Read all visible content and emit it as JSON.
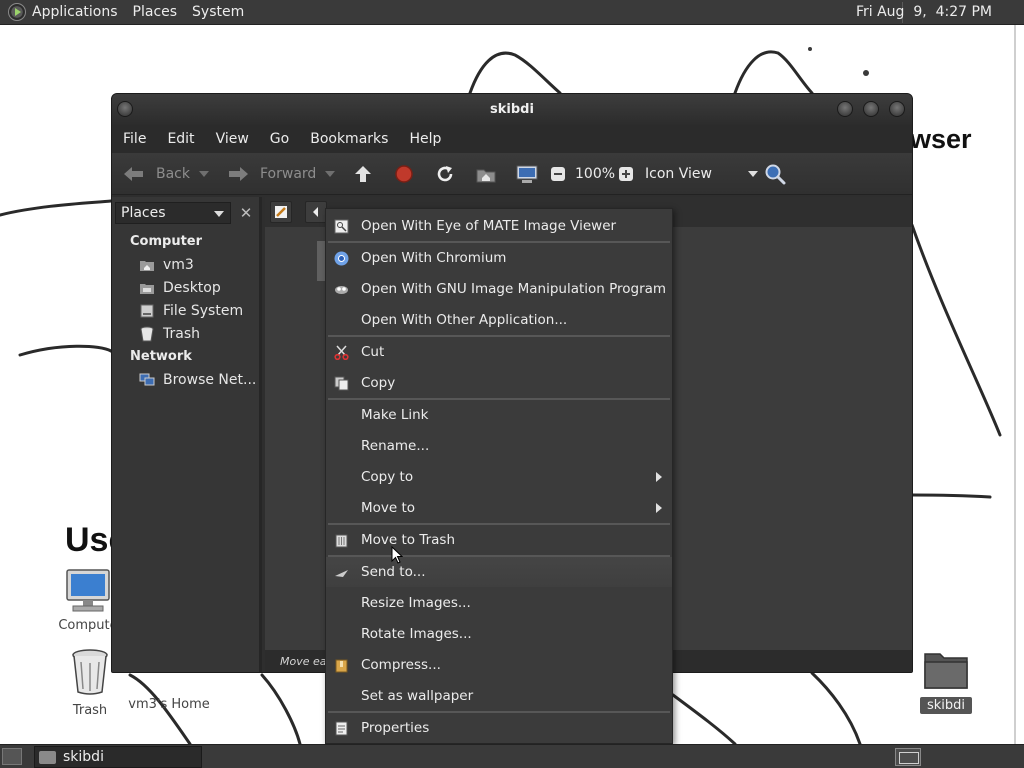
{
  "top_panel": {
    "menus": [
      "Applications",
      "Places",
      "System"
    ],
    "clock": "Fri Aug  9,  4:27 PM"
  },
  "desktop": {
    "bg_text_left": "Use",
    "bg_text_right": "wser",
    "icons": [
      {
        "label": "Compute",
        "icon": "computer-icon"
      },
      {
        "label": "Trash",
        "icon": "trash-icon"
      },
      {
        "label": "vm3's Home",
        "icon": "home-folder-icon"
      },
      {
        "label": "skibdi",
        "icon": "folder-icon"
      }
    ]
  },
  "window": {
    "title": "skibdi",
    "menu": [
      "File",
      "Edit",
      "View",
      "Go",
      "Bookmarks",
      "Help"
    ],
    "toolbar": {
      "back": "Back",
      "forward": "Forward",
      "zoom": "100%",
      "view_mode": "Icon View"
    },
    "sidebar": {
      "selector": "Places",
      "sections": [
        {
          "title": "Computer",
          "items": [
            {
              "label": "vm3",
              "icon": "home-icon"
            },
            {
              "label": "Desktop",
              "icon": "desktop-icon"
            },
            {
              "label": "File System",
              "icon": "drive-icon"
            },
            {
              "label": "Trash",
              "icon": "trash-icon"
            }
          ]
        },
        {
          "title": "Network",
          "items": [
            {
              "label": "Browse Net...",
              "icon": "network-icon"
            }
          ]
        }
      ]
    },
    "status": "Move eac"
  },
  "context_menu": {
    "items": [
      {
        "label": "Open With Eye of MATE Image Viewer",
        "icon": "image-viewer-icon"
      },
      {
        "label": "Open With Chromium",
        "icon": "chromium-icon"
      },
      {
        "label": "Open With GNU Image Manipulation Program",
        "icon": "gimp-icon"
      },
      {
        "label": "Open With Other Application...",
        "icon": ""
      },
      {
        "label": "Cut",
        "icon": "scissors-icon"
      },
      {
        "label": "Copy",
        "icon": "copy-icon"
      },
      {
        "label": "Make Link",
        "icon": ""
      },
      {
        "label": "Rename...",
        "icon": ""
      },
      {
        "label": "Copy to",
        "icon": "",
        "submenu": true
      },
      {
        "label": "Move to",
        "icon": "",
        "submenu": true
      },
      {
        "label": "Move to Trash",
        "icon": "trash-icon"
      },
      {
        "label": "Send to...",
        "icon": "send-icon",
        "hovered": true
      },
      {
        "label": "Resize Images...",
        "icon": ""
      },
      {
        "label": "Rotate Images...",
        "icon": ""
      },
      {
        "label": "Compress...",
        "icon": "archive-icon"
      },
      {
        "label": "Set as wallpaper",
        "icon": ""
      },
      {
        "label": "Properties",
        "icon": "properties-icon"
      }
    ]
  },
  "bottom_panel": {
    "task": "skibdi"
  }
}
